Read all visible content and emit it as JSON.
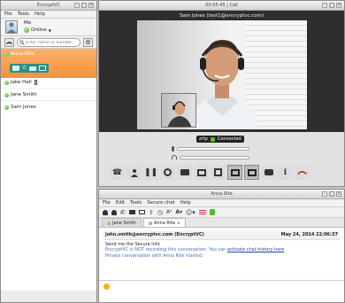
{
  "contacts_window": {
    "title": "EncryptVC",
    "menu": [
      "File",
      "Tools",
      "Help"
    ],
    "me_label": "Me",
    "status": "Online",
    "search_placeholder": "Enter name or number",
    "contacts": [
      {
        "name": "Anna Rite",
        "selected": true
      },
      {
        "name": "Jake Hall",
        "selected": false
      },
      {
        "name": "Jane Smith",
        "selected": false
      },
      {
        "name": "Sam Jones",
        "selected": false
      }
    ]
  },
  "call_window": {
    "title": "00:05:45 | Call",
    "caller": "Sam Jones (test1@encryptvc.com)",
    "zrtp_label": "zrtp",
    "connected_label": "Connected",
    "toolbar_icons": [
      "dialpad-icon",
      "transfer-icon",
      "hold-icon",
      "record-icon",
      "video-icon",
      "screen-share-icon",
      "fullscreen-icon",
      "layout-single-icon",
      "layout-pip-icon",
      "chat-icon",
      "info-icon",
      "hangup-icon"
    ]
  },
  "chat_window": {
    "title": "Anna Rite",
    "menu": [
      "File",
      "Edit",
      "Tools",
      "Secure chat",
      "Help"
    ],
    "tabs": [
      {
        "label": "Jane Smith",
        "active": false
      },
      {
        "label": "Anna Rite",
        "active": true
      }
    ],
    "message": {
      "sender": "john.smith@encryptvc.com (EncryptVC)",
      "timestamp": "May 24, 2014 22:06:37",
      "body": "Send me the Secure info",
      "system_notice_prefix": "EncryptVC is NOT recording this conversation. You can ",
      "system_notice_link": "activate chat history here",
      "system_notice_suffix": ".",
      "private_notice": "Private conversation with Anna Rite started."
    }
  },
  "colors": {
    "accent_orange": "#f7923a",
    "online_green": "#5cb82a",
    "hangup_red": "#d8261c"
  }
}
